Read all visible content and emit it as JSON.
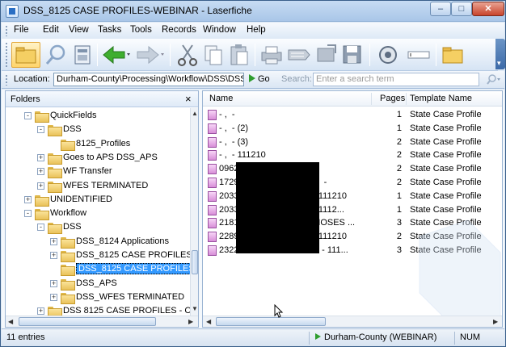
{
  "window": {
    "title": "DSS_8125 CASE PROFILES-WEBINAR - Laserfiche"
  },
  "menu": [
    "File",
    "Edit",
    "View",
    "Tasks",
    "Tools",
    "Records",
    "Window",
    "Help"
  ],
  "toolbar": {
    "buttons": [
      "folder-view-icon",
      "search-icon",
      "metadata-icon",
      "back-icon",
      "forward-icon",
      "cut-icon",
      "copy-icon",
      "paste-icon",
      "print-icon",
      "send-icon",
      "export-icon",
      "save-icon",
      "properties-icon",
      "rename-icon",
      "new-folder-icon"
    ]
  },
  "location": {
    "label": "Location:",
    "path": "Durham-County\\Processing\\Workflow\\DSS\\DSS",
    "go_label": "Go",
    "search_label": "Search:",
    "search_placeholder": "Enter a search term"
  },
  "folders": {
    "title": "Folders",
    "close": "×",
    "tree": [
      {
        "label": "QuickFields",
        "indent": 0,
        "expander": "-"
      },
      {
        "label": "DSS",
        "indent": 1,
        "expander": "-"
      },
      {
        "label": "8125_Profiles",
        "indent": 2,
        "expander": ""
      },
      {
        "label": "Goes to APS DSS_APS",
        "indent": 1,
        "expander": "+"
      },
      {
        "label": "WF Transfer",
        "indent": 1,
        "expander": "+"
      },
      {
        "label": "WFES TERMINATED",
        "indent": 1,
        "expander": "+"
      },
      {
        "label": "UNIDENTIFIED",
        "indent": 0,
        "expander": "+"
      },
      {
        "label": "Workflow",
        "indent": 0,
        "expander": "-"
      },
      {
        "label": "DSS",
        "indent": 1,
        "expander": "-"
      },
      {
        "label": "DSS_8124 Applications",
        "indent": 2,
        "expander": "+"
      },
      {
        "label": "DSS_8125 CASE PROFILES",
        "indent": 2,
        "expander": "+"
      },
      {
        "label": "DSS_8125 CASE PROFILES",
        "indent": 2,
        "expander": "",
        "selected": true
      },
      {
        "label": "DSS_APS",
        "indent": 2,
        "expander": "+"
      },
      {
        "label": "DSS_WFES TERMINATED",
        "indent": 2,
        "expander": "+"
      },
      {
        "label": "DSS 8125 CASE PROFILES - C",
        "indent": 1,
        "expander": "+"
      }
    ]
  },
  "files": {
    "columns": {
      "name": "Name",
      "pages": "Pages",
      "template": "Template Name"
    },
    "rows": [
      {
        "name": "- ,  -",
        "pages": "1",
        "template": "State Case Profile"
      },
      {
        "name": "- ,  - (2)",
        "pages": "1",
        "template": "State Case Profile"
      },
      {
        "name": "- ,  - (3)",
        "pages": "2",
        "template": "State Case Profile"
      },
      {
        "name": "- ,  - 111210",
        "pages": "2",
        "template": "State Case Profile"
      },
      {
        "name": "0962",
        "pages": "2",
        "template": "State Case Profile"
      },
      {
        "name": "1729                              E  -",
        "pages": "2",
        "template": "State Case Profile"
      },
      {
        "name": "2033                              - 111210",
        "pages": "1",
        "template": "State Case Profile"
      },
      {
        "name": "2033                              - 1112...",
        "pages": "1",
        "template": "State Case Profile"
      },
      {
        "name": "2181                              MOSES ...",
        "pages": "3",
        "template": "State Case Profile"
      },
      {
        "name": "2289                              - 111210",
        "pages": "2",
        "template": "State Case Profile"
      },
      {
        "name": "2322                              D - 111...",
        "pages": "3",
        "template": "State Case Profile"
      }
    ]
  },
  "status": {
    "entries": "11 entries",
    "repository": "Durham-County (WEBINAR)",
    "num": "NUM"
  },
  "colors": {
    "selection": "#3399ff",
    "titlebar": "#a9c6e8",
    "document_icon": "#d88ed8",
    "folder_icon": "#e9c25a"
  }
}
